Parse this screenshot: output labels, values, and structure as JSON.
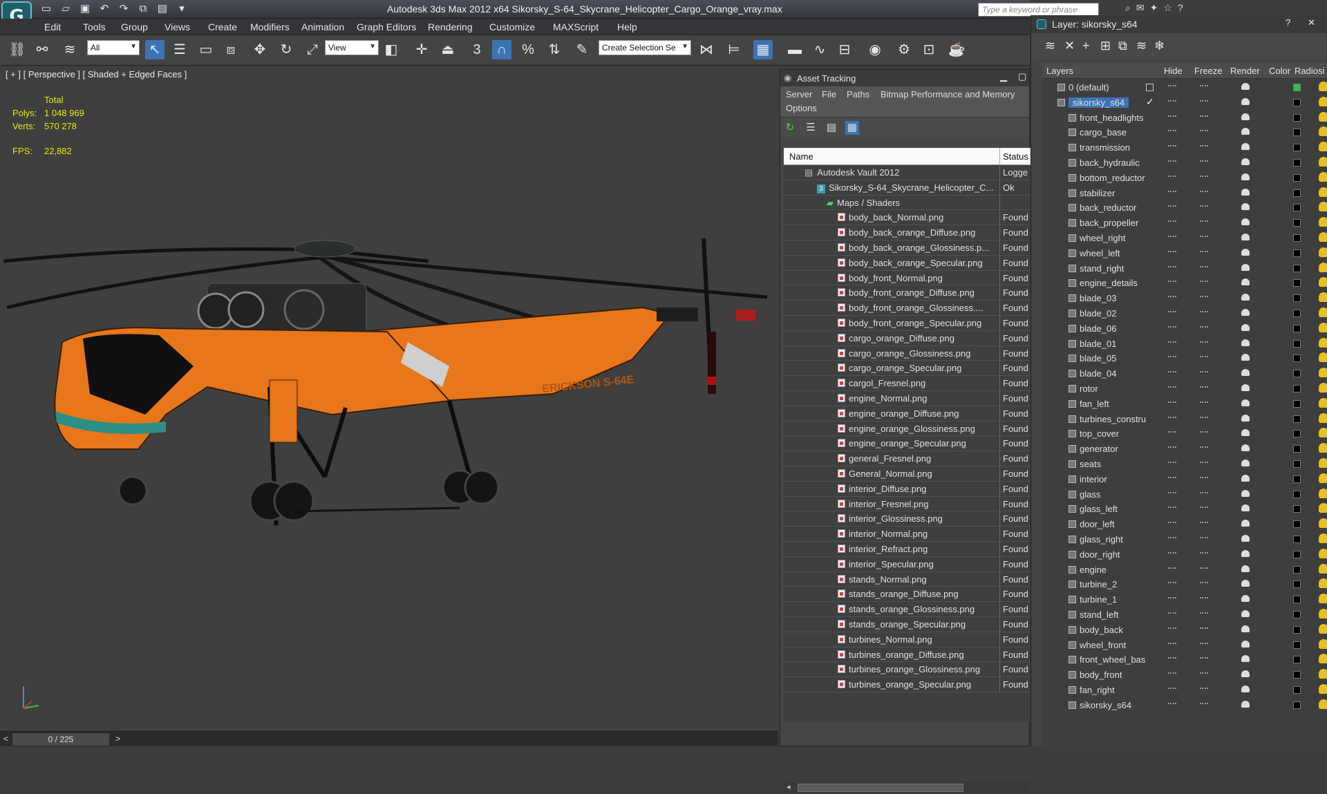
{
  "title": "Autodesk 3ds Max  2012 x64      Sikorsky_S-64_Skycrane_Helicopter_Cargo_Orange_vray.max",
  "search_placeholder": "Type a keyword or phrase",
  "menu": [
    "Edit",
    "Tools",
    "Group",
    "Views",
    "Create",
    "Modifiers",
    "Animation",
    "Graph Editors",
    "Rendering",
    "Customize",
    "MAXScript",
    "Help"
  ],
  "toolbar": {
    "filter_value": "All",
    "refcoord_value": "View",
    "selection_set_value": "Create Selection Se",
    "snap_number": "3"
  },
  "viewport": {
    "label": "[ + ] [ Perspective ] [ Shaded + Edged Faces ]",
    "stats_header": "Total",
    "polys_label": "Polys:",
    "polys_value": "1 048 969",
    "verts_label": "Verts:",
    "verts_value": "570 278",
    "fps_label": "FPS:",
    "fps_value": "22,882",
    "heli_text": "ERICKSON  S-64E"
  },
  "timeline": {
    "position": "0 / 225",
    "left_arrow": "<",
    "right_arrow": ">"
  },
  "asset_tracking": {
    "title": "Asset Tracking",
    "menu": [
      "Server",
      "File",
      "Paths",
      "Bitmap Performance and Memory",
      "Options"
    ],
    "col_name": "Name",
    "col_status": "Status",
    "rows": [
      {
        "name": "Autodesk Vault 2012",
        "status": "Logge",
        "level": 0
      },
      {
        "name": "Sikorsky_S-64_Skycrane_Helicopter_C...",
        "status": "Ok",
        "level": 1
      },
      {
        "name": "Maps / Shaders",
        "status": "",
        "level": 2
      },
      {
        "name": "body_back_Normal.png",
        "status": "Found",
        "level": 3
      },
      {
        "name": "body_back_orange_Diffuse.png",
        "status": "Found",
        "level": 3
      },
      {
        "name": "body_back_orange_Glossiness.p...",
        "status": "Found",
        "level": 3
      },
      {
        "name": "body_back_orange_Specular.png",
        "status": "Found",
        "level": 3
      },
      {
        "name": "body_front_Normal.png",
        "status": "Found",
        "level": 3
      },
      {
        "name": "body_front_orange_Diffuse.png",
        "status": "Found",
        "level": 3
      },
      {
        "name": "body_front_orange_Glossiness....",
        "status": "Found",
        "level": 3
      },
      {
        "name": "body_front_orange_Specular.png",
        "status": "Found",
        "level": 3
      },
      {
        "name": "cargo_orange_Diffuse.png",
        "status": "Found",
        "level": 3
      },
      {
        "name": "cargo_orange_Glossiness.png",
        "status": "Found",
        "level": 3
      },
      {
        "name": "cargo_orange_Specular.png",
        "status": "Found",
        "level": 3
      },
      {
        "name": "cargol_Fresnel.png",
        "status": "Found",
        "level": 3
      },
      {
        "name": "engine_Normal.png",
        "status": "Found",
        "level": 3
      },
      {
        "name": "engine_orange_Diffuse.png",
        "status": "Found",
        "level": 3
      },
      {
        "name": "engine_orange_Glossiness.png",
        "status": "Found",
        "level": 3
      },
      {
        "name": "engine_orange_Specular.png",
        "status": "Found",
        "level": 3
      },
      {
        "name": "general_Fresnel.png",
        "status": "Found",
        "level": 3
      },
      {
        "name": "General_Normal.png",
        "status": "Found",
        "level": 3
      },
      {
        "name": "interior_Diffuse.png",
        "status": "Found",
        "level": 3
      },
      {
        "name": "interior_Fresnel.png",
        "status": "Found",
        "level": 3
      },
      {
        "name": "interior_Glossiness.png",
        "status": "Found",
        "level": 3
      },
      {
        "name": "interior_Normal.png",
        "status": "Found",
        "level": 3
      },
      {
        "name": "interior_Refract.png",
        "status": "Found",
        "level": 3
      },
      {
        "name": "interior_Specular.png",
        "status": "Found",
        "level": 3
      },
      {
        "name": "stands_Normal.png",
        "status": "Found",
        "level": 3
      },
      {
        "name": "stands_orange_Diffuse.png",
        "status": "Found",
        "level": 3
      },
      {
        "name": "stands_orange_Glossiness.png",
        "status": "Found",
        "level": 3
      },
      {
        "name": "stands_orange_Specular.png",
        "status": "Found",
        "level": 3
      },
      {
        "name": "turbines_Normal.png",
        "status": "Found",
        "level": 3
      },
      {
        "name": "turbines_orange_Diffuse.png",
        "status": "Found",
        "level": 3
      },
      {
        "name": "turbines_orange_Glossiness.png",
        "status": "Found",
        "level": 3
      },
      {
        "name": "turbines_orange_Specular.png",
        "status": "Found",
        "level": 3
      }
    ]
  },
  "layer_panel": {
    "title": "Layer: sikorsky_s64",
    "help": "?",
    "cols": [
      "Layers",
      "Hide",
      "Freeze",
      "Render",
      "Color",
      "Radiosi"
    ],
    "default_layer": "0 (default)",
    "active_layer": "sikorsky_s64",
    "objects": [
      "front_headlights",
      "cargo_base",
      "transmission",
      "back_hydraulic",
      "bottom_reductor",
      "stabilizer",
      "back_reductor",
      "back_propeller",
      "wheel_right",
      "wheel_left",
      "stand_right",
      "engine_details",
      "blade_03",
      "blade_02",
      "blade_06",
      "blade_01",
      "blade_05",
      "blade_04",
      "rotor",
      "fan_left",
      "turbines_constru",
      "top_cover",
      "generator",
      "seats",
      "interior",
      "glass",
      "glass_left",
      "door_left",
      "glass_right",
      "door_right",
      "engine",
      "turbine_2",
      "turbine_1",
      "stand_left",
      "body_back",
      "wheel_front",
      "front_wheel_bas",
      "body_front",
      "fan_right",
      "sikorsky_s64"
    ],
    "colors": {
      "default": "#2fc04a",
      "object": "#000000"
    }
  },
  "colors": {
    "accent": "#3b74b3",
    "fuselage": "#e8761a",
    "stats": "#e8e800"
  }
}
